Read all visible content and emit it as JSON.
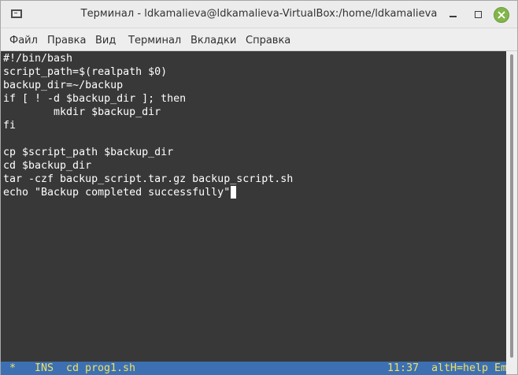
{
  "window": {
    "title": "Терминал - ldkamalieva@ldkamalieva-VirtualBox:/home/ldkamalieva",
    "accent": "#82b54a"
  },
  "menubar": {
    "items": [
      "Файл",
      "Правка",
      "Вид",
      "Терминал",
      "Вкладки",
      "Справка"
    ]
  },
  "terminal": {
    "lines": [
      "#!/bin/bash",
      "script_path=$(realpath $0)",
      "backup_dir=~/backup",
      "if [ ! -d $backup_dir ]; then",
      "        mkdir $backup_dir",
      "fi",
      "",
      "cp $script_path $backup_dir",
      "cd $backup_dir",
      "tar -czf backup_script.tar.gz backup_script.sh",
      "echo \"Backup completed successfully\""
    ],
    "background": "#383838",
    "foreground": "#ffffff"
  },
  "statusbar": {
    "modified": "*",
    "mode": "INS",
    "command": "cd prog1.sh",
    "time": "11:37",
    "help": "altH=help Em",
    "background": "#3d70b2",
    "foreground": "#f0e060"
  }
}
